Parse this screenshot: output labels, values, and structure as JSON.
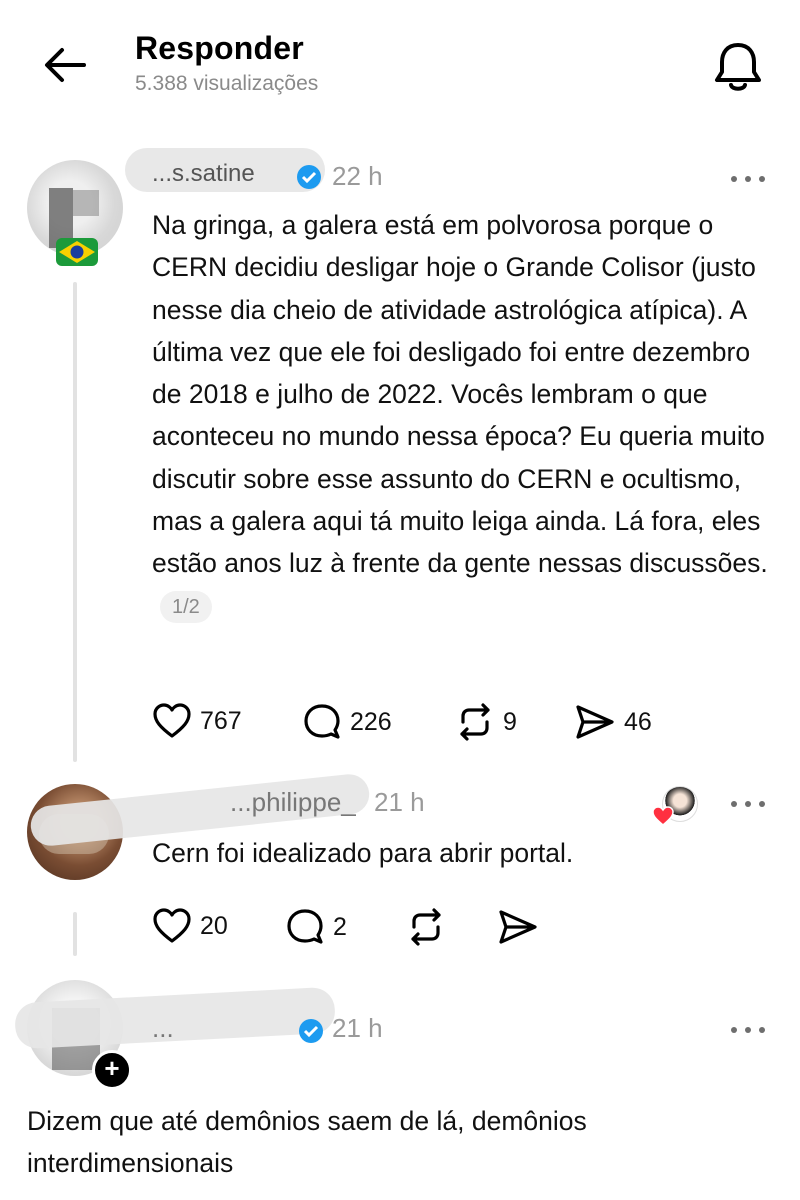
{
  "header": {
    "title": "Responder",
    "views": "5.388 visualizações",
    "back_icon": "back-arrow-icon",
    "bell_icon": "bell-icon"
  },
  "posts": [
    {
      "username": "...s.satine",
      "time": "22 h",
      "text": "Na gringa, a galera está em polvorosa porque o CERN decidiu desligar hoje o Grande Colisor (justo nesse dia cheio de atividade astrológica atípica). A última vez que ele foi desligado foi entre dezembro de 2018 e julho de 2022. Vocês lembram o que aconteceu no mundo nessa época? Eu queria muito discutir sobre esse assunto do CERN e ocultismo, mas a galera aqui tá muito leiga ainda. Lá fora, eles estão anos luz à frente da gente nessas discussões.",
      "pager": "1/2",
      "likes": "767",
      "comments": "226",
      "reposts": "9",
      "shares": "46"
    },
    {
      "username": "...philippe_",
      "time": "21 h",
      "text": "Cern foi idealizado para abrir portal.",
      "likes": "20",
      "comments": "2"
    },
    {
      "username": "...",
      "time": "21 h",
      "text": "Dizem que até demônios saem de lá, demônios interdimensionais"
    }
  ],
  "colors": {
    "muted": "#8a8a8a",
    "verified": "#1d9bf0",
    "heart": "#ff3040"
  }
}
